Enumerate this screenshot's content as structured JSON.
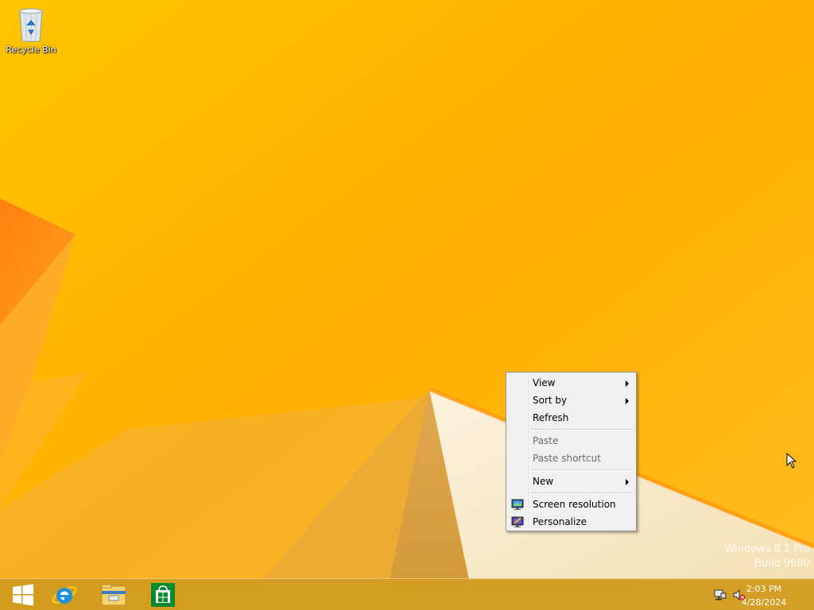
{
  "desktop": {
    "icons": [
      {
        "label": "Recycle Bin",
        "icon": "recycle-bin-icon"
      }
    ],
    "watermark": {
      "line1": "Windows 8.1 Pro",
      "line2": "Build 9600"
    }
  },
  "context_menu": {
    "items": [
      {
        "label": "View",
        "submenu": true,
        "enabled": true
      },
      {
        "label": "Sort by",
        "submenu": true,
        "enabled": true
      },
      {
        "label": "Refresh",
        "submenu": false,
        "enabled": true
      },
      {
        "label": "Paste",
        "submenu": false,
        "enabled": false
      },
      {
        "label": "Paste shortcut",
        "submenu": false,
        "enabled": false
      },
      {
        "label": "New",
        "submenu": true,
        "enabled": true
      },
      {
        "label": "Screen resolution",
        "submenu": false,
        "enabled": true,
        "icon": "display-icon"
      },
      {
        "label": "Personalize",
        "submenu": false,
        "enabled": true,
        "icon": "personalize-icon"
      }
    ]
  },
  "taskbar": {
    "pinned": [
      {
        "name": "Start",
        "icon": "windows-logo-icon"
      },
      {
        "name": "Internet Explorer",
        "icon": "internet-explorer-icon"
      },
      {
        "name": "File Explorer",
        "icon": "file-explorer-icon"
      },
      {
        "name": "Store",
        "icon": "store-icon"
      }
    ],
    "tray": {
      "icons": [
        "network-icon",
        "volume-muted-icon"
      ],
      "time": "2:03 PM",
      "date": "4/28/2024"
    }
  },
  "colors": {
    "wallpaper": "#ffb800",
    "taskbar": "#c4962a",
    "menu_bg": "#f0f0f0",
    "store_green": "#0a8a2f",
    "ie_blue": "#1e8fe0"
  }
}
